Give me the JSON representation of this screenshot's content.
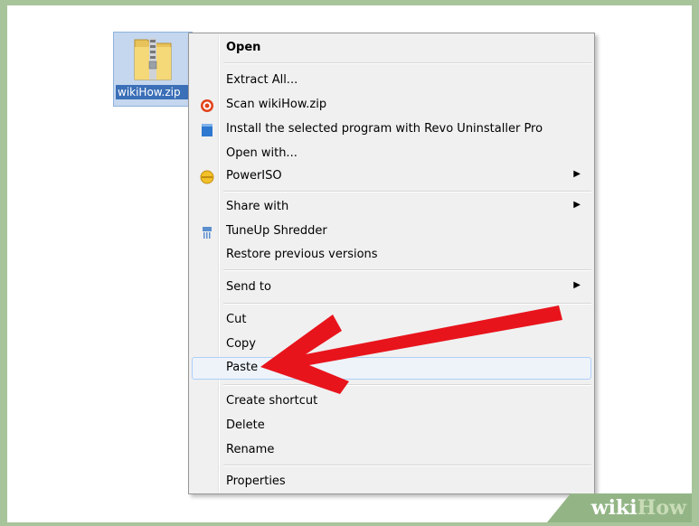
{
  "file": {
    "label": "wikiHow.zip"
  },
  "menu": {
    "items": [
      {
        "label": "Open",
        "bold": true
      },
      {
        "label": "Extract All..."
      },
      {
        "label": "Scan wikiHow.zip",
        "icon": "scan-icon"
      },
      {
        "label": "Install the selected program with Revo Uninstaller Pro",
        "icon": "revo-icon"
      },
      {
        "label": "Open with..."
      },
      {
        "label": "PowerISO",
        "icon": "poweriso-icon",
        "submenu": true
      },
      {
        "label": "Share with",
        "submenu": true
      },
      {
        "label": "TuneUp Shredder",
        "icon": "shredder-icon"
      },
      {
        "label": "Restore previous versions"
      },
      {
        "label": "Send to",
        "submenu": true
      },
      {
        "label": "Cut"
      },
      {
        "label": "Copy"
      },
      {
        "label": "Paste",
        "highlighted": true
      },
      {
        "label": "Create shortcut"
      },
      {
        "label": "Delete"
      },
      {
        "label": "Rename"
      },
      {
        "label": "Properties"
      }
    ]
  },
  "watermark": {
    "part1": "wiki",
    "part2": "How"
  },
  "colors": {
    "background": "#a7c49a",
    "arrow": "#e8141c",
    "highlight": "#aecff7"
  }
}
